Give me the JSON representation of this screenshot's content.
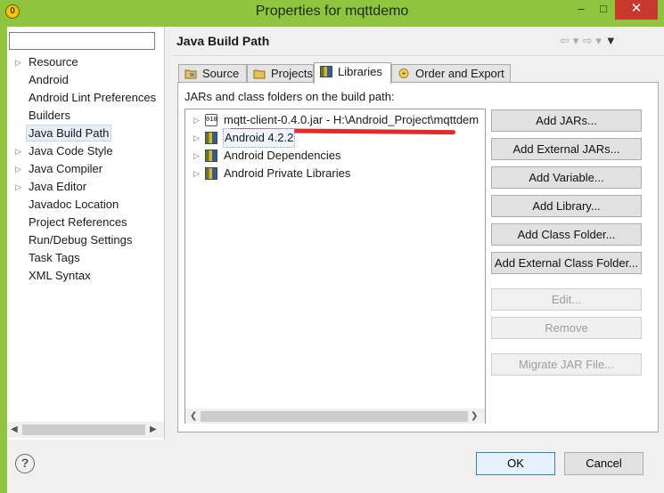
{
  "window": {
    "title": "Properties for mqttdemo"
  },
  "filter": {
    "value": "",
    "placeholder": ""
  },
  "nav": {
    "items": [
      {
        "label": "Resource",
        "expandable": true
      },
      {
        "label": "Android",
        "expandable": false
      },
      {
        "label": "Android Lint Preferences",
        "expandable": false
      },
      {
        "label": "Builders",
        "expandable": false
      },
      {
        "label": "Java Build Path",
        "expandable": false,
        "selected": true
      },
      {
        "label": "Java Code Style",
        "expandable": true
      },
      {
        "label": "Java Compiler",
        "expandable": true
      },
      {
        "label": "Java Editor",
        "expandable": true
      },
      {
        "label": "Javadoc Location",
        "expandable": false
      },
      {
        "label": "Project References",
        "expandable": false
      },
      {
        "label": "Run/Debug Settings",
        "expandable": false
      },
      {
        "label": "Task Tags",
        "expandable": false
      },
      {
        "label": "XML Syntax",
        "expandable": false
      }
    ]
  },
  "page": {
    "title": "Java Build Path",
    "tabs": [
      {
        "label": "Source"
      },
      {
        "label": "Projects"
      },
      {
        "label": "Libraries",
        "active": true
      },
      {
        "label": "Order and Export"
      }
    ],
    "panel_label": "JARs and class folders on the build path:",
    "tree": [
      {
        "label": "mqtt-client-0.4.0.jar - H:\\Android_Project\\mqttdem",
        "icon": "jar-icon"
      },
      {
        "label": "Android 4.2.2",
        "icon": "library-icon",
        "selected": true
      },
      {
        "label": "Android Dependencies",
        "icon": "library-icon"
      },
      {
        "label": "Android Private Libraries",
        "icon": "library-icon"
      }
    ],
    "buttons": {
      "add_jars": "Add JARs...",
      "add_external_jars": "Add External JARs...",
      "add_variable": "Add Variable...",
      "add_library": "Add Library...",
      "add_class_folder": "Add Class Folder...",
      "add_external_class_folder": "Add External Class Folder...",
      "edit": "Edit...",
      "remove": "Remove",
      "migrate_jar": "Migrate JAR File..."
    }
  },
  "footer": {
    "help": "?",
    "ok": "OK",
    "cancel": "Cancel"
  },
  "colors": {
    "titlebar": "#8fc43f",
    "close": "#c7392c",
    "annotation": "#e12a2a"
  }
}
